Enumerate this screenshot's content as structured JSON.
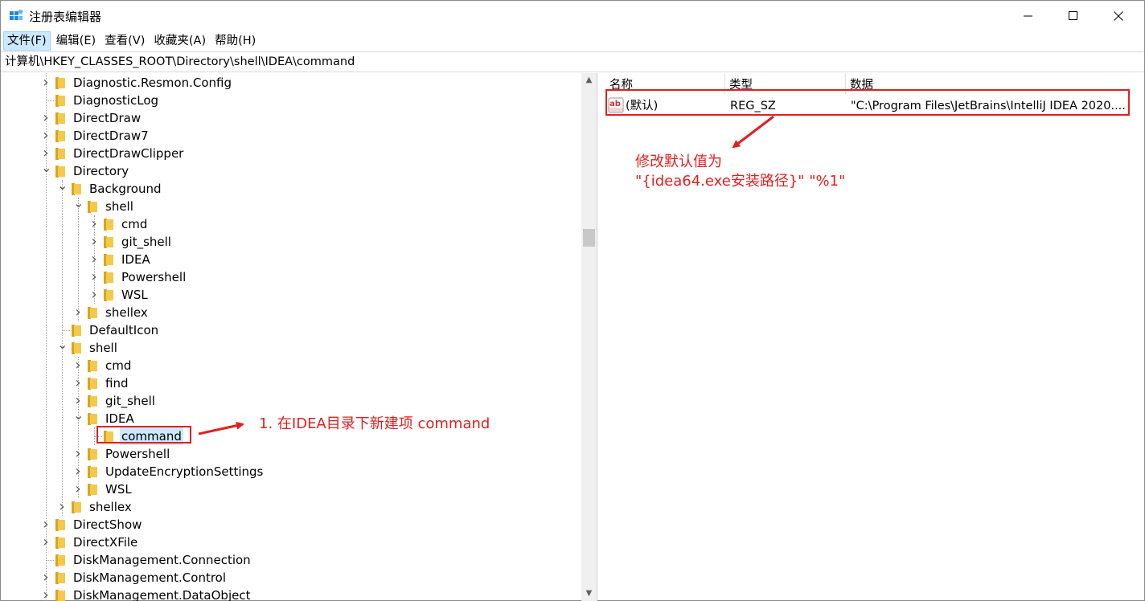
{
  "window": {
    "title": "注册表编辑器",
    "minimize_icon": "minimize-icon",
    "maximize_icon": "maximize-icon",
    "close_icon": "close-icon"
  },
  "menu": [
    "文件(F)",
    "编辑(E)",
    "查看(V)",
    "收藏夹(A)",
    "帮助(H)"
  ],
  "address": "计算机\\HKEY_CLASSES_ROOT\\Directory\\shell\\IDEA\\command",
  "tree": [
    {
      "label": "Diagnostic.Resmon.Config",
      "expander": ">"
    },
    {
      "label": "DiagnosticLog",
      "expander": ""
    },
    {
      "label": "DirectDraw",
      "expander": ">"
    },
    {
      "label": "DirectDraw7",
      "expander": ">"
    },
    {
      "label": "DirectDrawClipper",
      "expander": ">"
    },
    {
      "label": "Directory",
      "expander": "v"
    },
    {
      "label": "Background",
      "expander": "v"
    },
    {
      "label": "shell",
      "expander": "v"
    },
    {
      "label": "cmd",
      "expander": ">"
    },
    {
      "label": "git_shell",
      "expander": ">"
    },
    {
      "label": "IDEA",
      "expander": ">"
    },
    {
      "label": "Powershell",
      "expander": ">"
    },
    {
      "label": "WSL",
      "expander": ">"
    },
    {
      "label": "shellex",
      "expander": ">"
    },
    {
      "label": "DefaultIcon",
      "expander": ""
    },
    {
      "label": "shell",
      "expander": "v"
    },
    {
      "label": "cmd",
      "expander": ">"
    },
    {
      "label": "find",
      "expander": ">"
    },
    {
      "label": "git_shell",
      "expander": ">"
    },
    {
      "label": "IDEA",
      "expander": "v"
    },
    {
      "label": "command",
      "expander": "",
      "selected": true
    },
    {
      "label": "Powershell",
      "expander": ">"
    },
    {
      "label": "UpdateEncryptionSettings",
      "expander": ">"
    },
    {
      "label": "WSL",
      "expander": ">"
    },
    {
      "label": "shellex",
      "expander": ">"
    },
    {
      "label": "DirectShow",
      "expander": ">"
    },
    {
      "label": "DirectXFile",
      "expander": ">"
    },
    {
      "label": "DiskManagement.Connection",
      "expander": ""
    },
    {
      "label": "DiskManagement.Control",
      "expander": ">"
    },
    {
      "label": "DiskManagement.DataObject",
      "expander": ">"
    }
  ],
  "values": {
    "headers": {
      "name": "名称",
      "type": "类型",
      "data": "数据"
    },
    "rows": [
      {
        "name": "(默认)",
        "type": "REG_SZ",
        "data": "\"C:\\Program Files\\JetBrains\\IntelliJ IDEA 2020....",
        "icon": "string-value-icon"
      }
    ]
  },
  "annotations": {
    "note1": "1. 在IDEA目录下新建项 command",
    "note2_line1": "修改默认值为",
    "note2_line2": "\"{idea64.exe安装路径}\" \"%1\"",
    "color": "#e02020"
  },
  "colors": {
    "selection": "#cce8ff",
    "folder": "#f2c94c",
    "annotation": "#e02020"
  }
}
